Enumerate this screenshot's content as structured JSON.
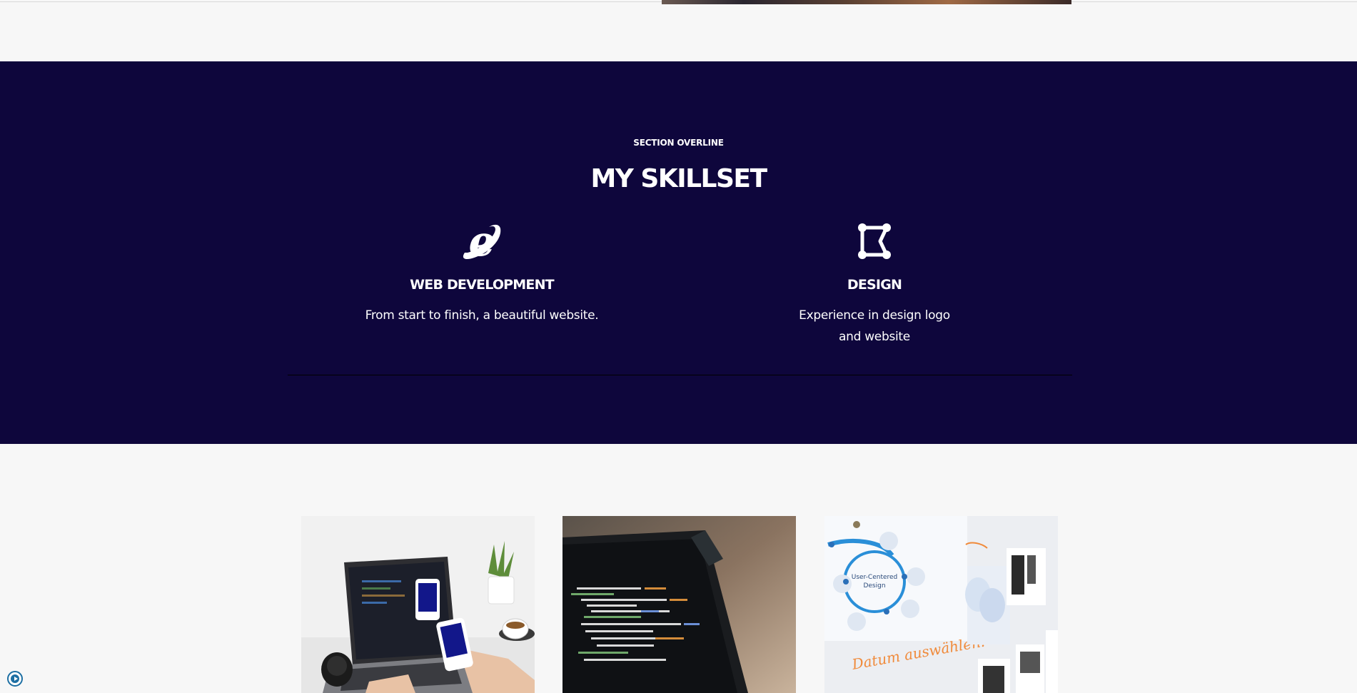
{
  "skills_section": {
    "overline": "SECTION OVERLINE",
    "title": "MY SKILLSET",
    "items": [
      {
        "icon": "internet-explorer-icon",
        "title": "WEB DEVELOPMENT",
        "description": "From start to finish, a beautiful website."
      },
      {
        "icon": "vector-pen-tool-icon",
        "title": "DESIGN",
        "description": "Experience in design logo and website"
      }
    ],
    "colors": {
      "background": "#0e063c",
      "text": "#ffffff"
    }
  },
  "portfolio": {
    "thumbnails": [
      {
        "subject": "laptop-and-phone-mockup"
      },
      {
        "subject": "laptop-with-code"
      },
      {
        "subject": "user-centered-design-wall",
        "labels": [
          "User-Centered",
          "Design",
          "Datum auswählen:"
        ]
      }
    ]
  },
  "colors": {
    "page_background": "#f7f7f7",
    "accent_blue": "#1d6fa3"
  }
}
